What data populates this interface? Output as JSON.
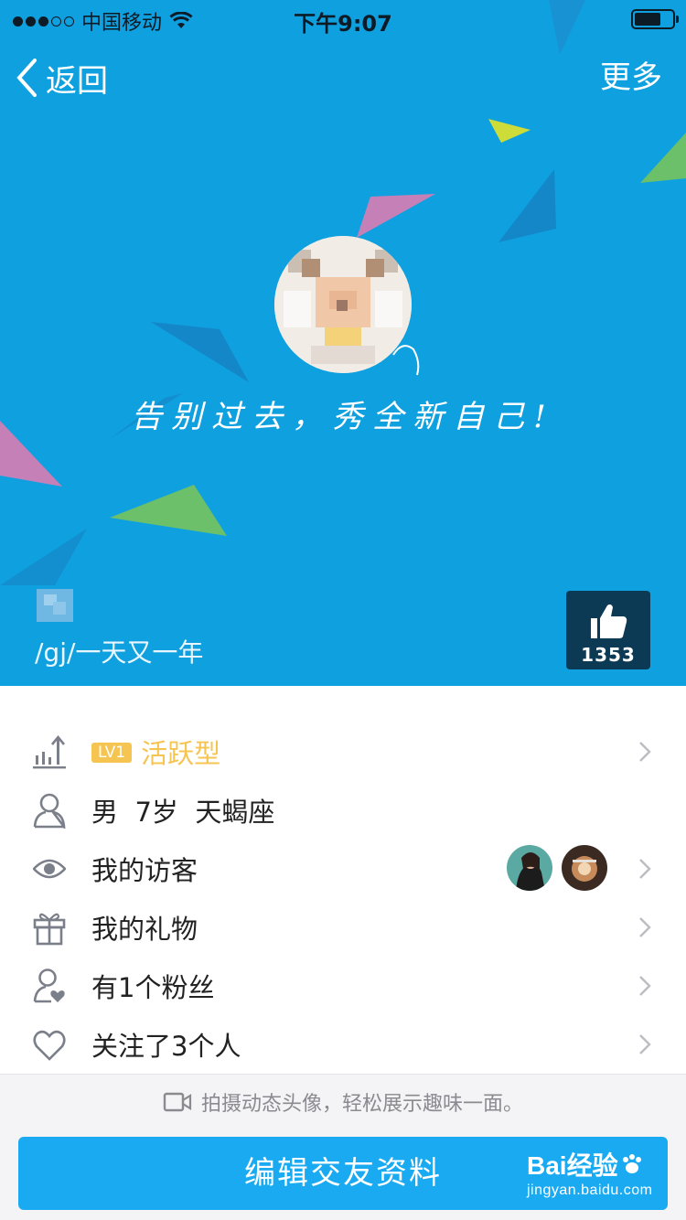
{
  "status_bar": {
    "carrier": "中国移动",
    "time": "下午9:07"
  },
  "nav": {
    "back_label": "返回",
    "more_label": "更多"
  },
  "profile": {
    "slogan": "告别过去，秀全新自己!",
    "signature": "/gj/一天又一年",
    "likes": "1353"
  },
  "list": {
    "level_badge": "LV1",
    "level_type": "活跃型",
    "gender": "男",
    "age": "7岁",
    "zodiac": "天蝎座",
    "visitors_label": "我的访客",
    "gifts_label": "我的礼物",
    "fans_label": "有1个粉丝",
    "following_label": "关注了3个人"
  },
  "bottom": {
    "tip": "拍摄动态头像，轻松展示趣味一面。",
    "edit_button": "编辑交友资料"
  },
  "watermark": {
    "brand": "Bai经验",
    "url": "jingyan.baidu.com"
  },
  "colors": {
    "banner": "#0fa0df",
    "accent": "#1aaaf1",
    "level": "#f5c451"
  }
}
